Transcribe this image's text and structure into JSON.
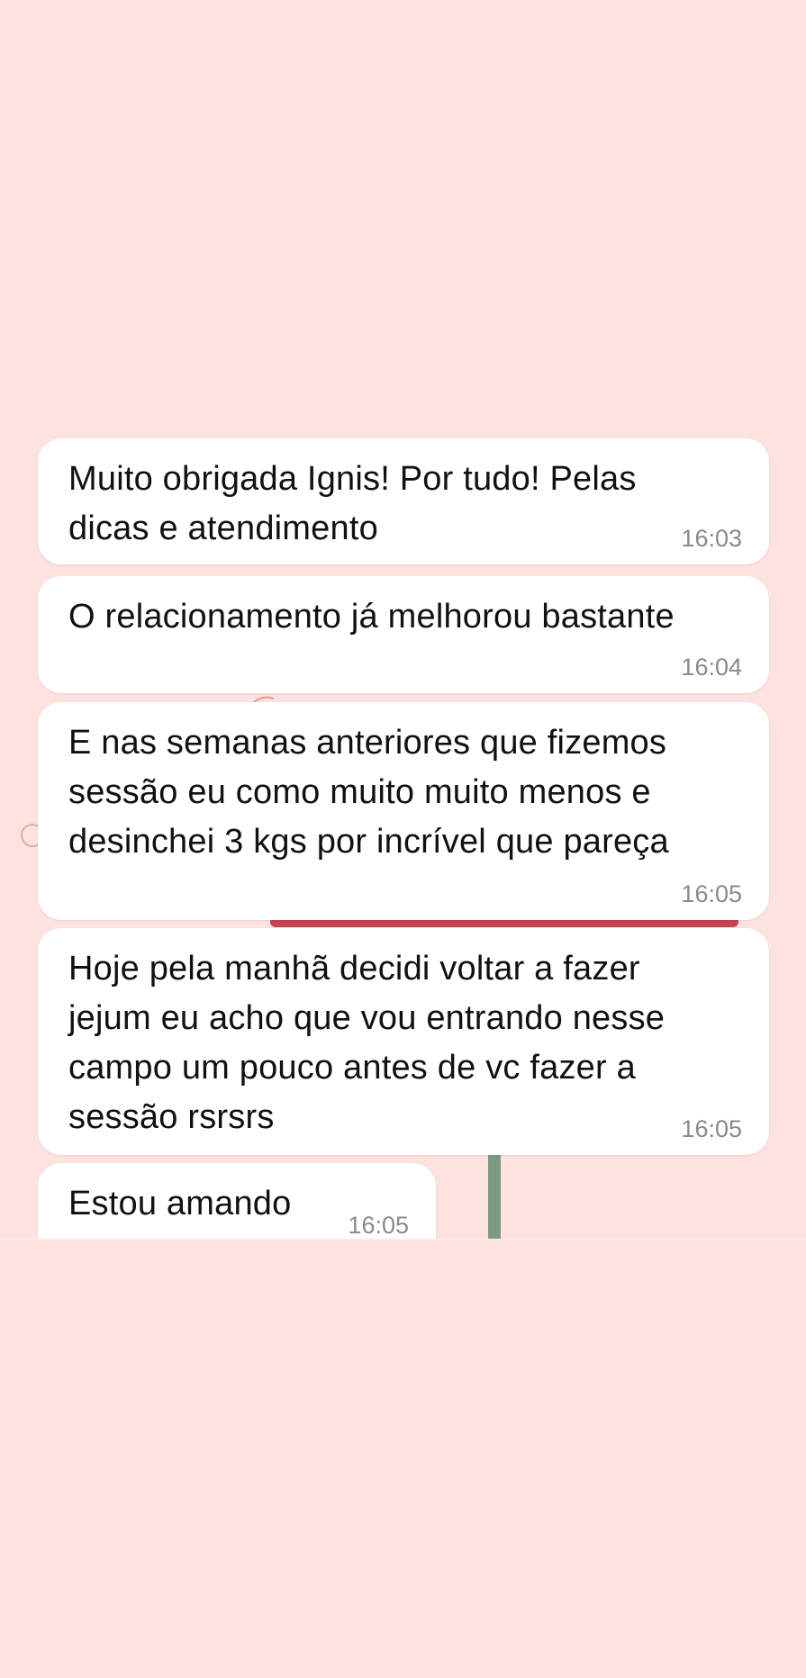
{
  "chat": {
    "colors": {
      "wallpaper": "#fde2df",
      "bubble": "#ffffff",
      "text": "#111111",
      "time": "#8a8a8a"
    },
    "messages": [
      {
        "text": "Muito obrigada Ignis! Por tudo! Pelas\ndicas e atendimento",
        "time": "16:03"
      },
      {
        "text": "O relacionamento já melhorou bastante",
        "time": "16:04"
      },
      {
        "text": "E nas semanas anteriores que fizemos\nsessão eu como muito muito menos e\ndesinchei 3 kgs por incrível que pareça",
        "time": "16:05"
      },
      {
        "text": "Hoje pela manhã decidi voltar a fazer\njejum eu acho que vou entrando nesse\ncampo um pouco antes de vc fazer a\nsessão rsrsrs",
        "time": "16:05"
      },
      {
        "text": "Estou amando",
        "time": "16:05"
      }
    ]
  }
}
